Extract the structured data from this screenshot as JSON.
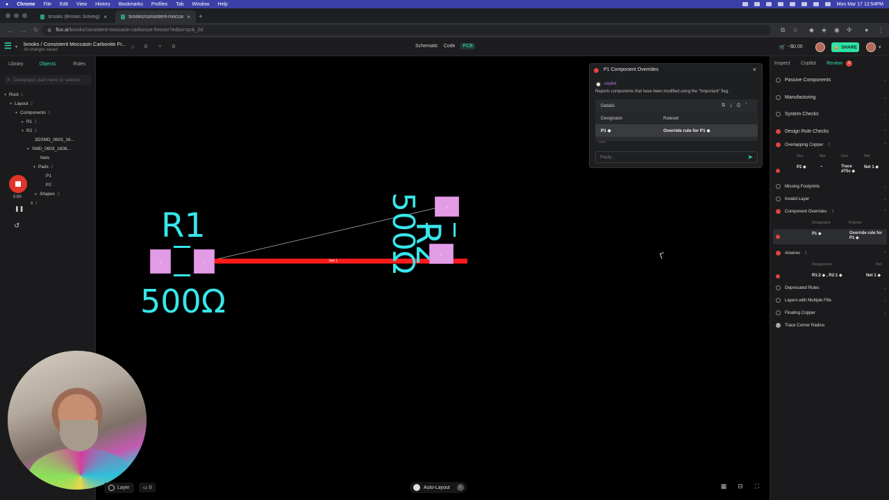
{
  "menubar": {
    "app": "Chrome",
    "items": [
      "File",
      "Edit",
      "View",
      "History",
      "Bookmarks",
      "Profiles",
      "Tab",
      "Window",
      "Help"
    ],
    "clock": "Mon Mar 17  12:54PM"
  },
  "tabs": [
    {
      "label": "brooks (Brooks Solveig) - Flux"
    },
    {
      "label": "brooks/consistent-moccasin-"
    }
  ],
  "address": {
    "host": "flux.ai",
    "path": "/brooks/consistent-moccasin-carbonize-freezer?editor=pcb_2d"
  },
  "header": {
    "project_title": "brooks / Consistent Moccasin Carbonite Fr...",
    "saved_status": "All changes saved",
    "stars": "0",
    "forks": "0",
    "modes": [
      "Schematic",
      "Code",
      "PCB"
    ],
    "active_mode": "PCB",
    "credit": "~$0.00",
    "share_label": "SHARE"
  },
  "left": {
    "tabs": [
      "Library",
      "Objects",
      "Rules"
    ],
    "active_tab": "Objects",
    "search_placeholder": "Designator, part name or selector",
    "tree": [
      {
        "label": "Root",
        "count": "1"
      },
      {
        "label": "Layout",
        "count": "2"
      },
      {
        "label": "Components",
        "count": "2"
      },
      {
        "label": "R1",
        "count": "2"
      },
      {
        "label": "R2",
        "count": "2"
      },
      {
        "label": "3DSMD_0603_16..."
      },
      {
        "label": "SMD_0603_1608..."
      },
      {
        "label": "Nets"
      },
      {
        "label": "Pads",
        "count": "2"
      },
      {
        "label": "P1"
      },
      {
        "label": "P2"
      },
      {
        "label": "Shapes",
        "count": "3"
      },
      {
        "label": "s",
        "count": "1"
      }
    ],
    "rec_time": "0:00"
  },
  "canvas": {
    "r1_label": "R1",
    "r1_value": "500Ω",
    "r2_label": "R2",
    "r2_value": "500Ω",
    "net_label": "Net 1",
    "pad_1": "1",
    "pad_2": "2",
    "layer_label": "Layer",
    "comments_count": "0",
    "autolayout_label": "Auto-Layout",
    "trace_color": "#ff1a1a",
    "silk_color": "#37e6ea",
    "pad_color": "#e29ce6"
  },
  "popup": {
    "title": "P1 Component Overrides",
    "author": "copilot",
    "description": "Reports components that have been modified using the \"!important\" flag.",
    "details_label": "Details",
    "col_designator": "Designator",
    "col_ruleset": "Ruleset",
    "row_designator": "P1 ◆",
    "row_ruleset": "Override rule for P1 ◆",
    "time": "Now",
    "reply_placeholder": "Reply..."
  },
  "right": {
    "tabs": [
      "Inspect",
      "Copilot",
      "Review"
    ],
    "active_tab": "Review",
    "review_badge": "3",
    "checks_top": [
      "Passive Components",
      "Manufacturing",
      "System Checks",
      "Design Rule Checks"
    ],
    "overlapping": {
      "label": "Overlapping Copper",
      "count": "· 1",
      "cols": [
        "Des",
        "Net",
        "Des",
        "Net"
      ],
      "row": [
        "P2 ◆",
        "–",
        "Trace d75c ◆",
        "Net 1 ◆"
      ]
    },
    "missing_footprints": "Missing Footprints",
    "invalid_layer": "Invalid Layer",
    "overrides": {
      "label": "Component Overrides",
      "count": "· 1",
      "cols": [
        "Designator",
        "Ruleset"
      ],
      "row": [
        "P1 ◆",
        "Override rule for P1 ◆"
      ]
    },
    "airwires": {
      "label": "Airwires",
      "count": "· 1",
      "cols": [
        "Designators",
        "Net"
      ],
      "row": [
        "R1:2 ◆ , R2:1 ◆",
        "Net 1 ◆"
      ]
    },
    "checks_bottom": [
      "Deprecated Rules",
      "Layers with Multiple Fills",
      "Floating Copper",
      "Trace Corner Radius"
    ]
  },
  "colors": {
    "accent": "#2fe0a5",
    "error": "#e0443e",
    "copilot": "#b979f0"
  }
}
